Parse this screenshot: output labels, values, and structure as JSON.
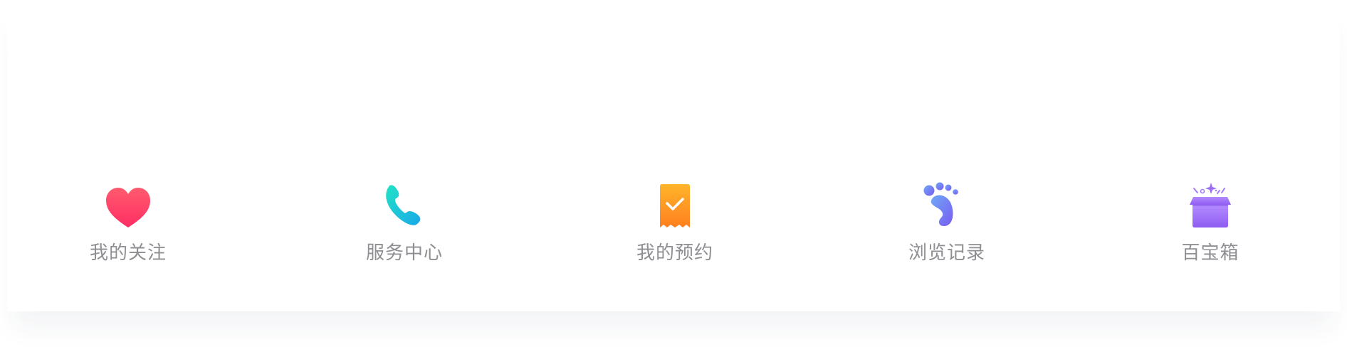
{
  "colors": {
    "label": "#8e8e93",
    "favorite_start": "#ff5a6e",
    "favorite_end": "#ff2e63",
    "service_start": "#22e2c6",
    "service_end": "#1aa8e8",
    "booking_start": "#ffb42a",
    "booking_end": "#ff7f1f",
    "history_start": "#6ea8f8",
    "history_end": "#7a5cf0",
    "treasure_start": "#b48cff",
    "treasure_end": "#8f5cf2"
  },
  "nav": {
    "items": [
      {
        "icon": "heart-icon",
        "label": "我的关注"
      },
      {
        "icon": "phone-icon",
        "label": "服务中心"
      },
      {
        "icon": "receipt-check-icon",
        "label": "我的预约"
      },
      {
        "icon": "footprint-icon",
        "label": "浏览记录"
      },
      {
        "icon": "gift-box-icon",
        "label": "百宝箱"
      }
    ]
  }
}
